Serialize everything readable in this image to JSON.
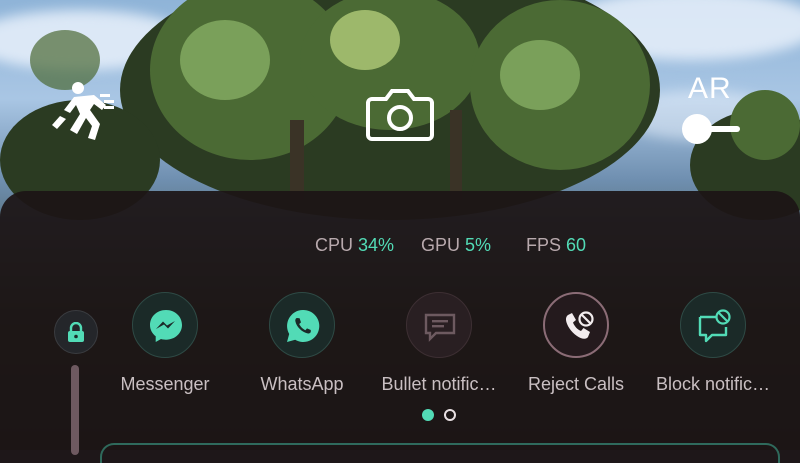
{
  "top_controls": {
    "runner_icon": "running-person-icon",
    "camera_icon": "camera-icon",
    "ar_label": "AR",
    "ar_toggle_state": "on"
  },
  "stats": [
    {
      "label": "CPU",
      "value": "34%"
    },
    {
      "label": "GPU",
      "value": "5%"
    },
    {
      "label": "FPS",
      "value": "60"
    }
  ],
  "side": {
    "lock_icon": "lock-icon"
  },
  "apps": [
    {
      "label": "Messenger",
      "icon": "messenger-icon",
      "state": "enabled"
    },
    {
      "label": "WhatsApp",
      "icon": "whatsapp-icon",
      "state": "enabled"
    },
    {
      "label": "Bullet notific…",
      "icon": "bullet-notification-icon",
      "state": "disabled"
    },
    {
      "label": "Reject Calls",
      "icon": "reject-calls-icon",
      "state": "active"
    },
    {
      "label": "Block notific…",
      "icon": "block-notification-icon",
      "state": "enabled"
    }
  ],
  "pagination": {
    "current": 1,
    "total": 2
  },
  "colors": {
    "accent": "#52dbb6",
    "panel_bg": "#1c1416",
    "label_text": "#c9bfc2",
    "stat_label": "#b8a9ad"
  }
}
